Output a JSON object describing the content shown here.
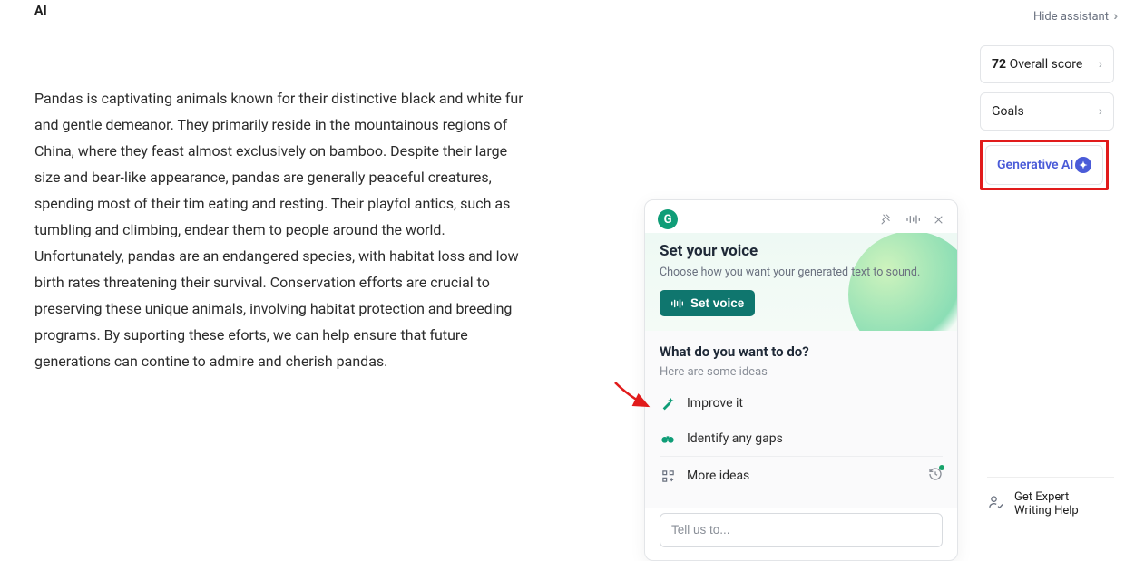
{
  "document": {
    "title": "AI",
    "body": "Pandas is captivating animals known for their distinctive black and white fur and gentle demeanor. They primarily reside in the mountainous regions of China, where they feast almost exclusively on bamboo. Despite their large size and bear-like appearance, pandas are generally peaceful creatures, spending most of their tim eating and resting. Their playfol antics, such as tumbling and climbing, endear them to people around the world. Unfortunately, pandas are an endangered species, with habitat loss and low birth rates threatening their survival. Conservation efforts are crucial to preserving these unique animals, involving habitat protection and breeding programs. By suporting these eforts, we can help ensure that future generations can contine to admire and cherish pandas."
  },
  "sidebar": {
    "hide_label": "Hide assistant",
    "score_num": "72",
    "score_label": "Overall score",
    "goals_label": "Goals",
    "genai_label": "Generative AI",
    "expert_line1": "Get Expert",
    "expert_line2": "Writing Help"
  },
  "assistant": {
    "logo_letter": "G",
    "voice_title": "Set your voice",
    "voice_sub": "Choose how you want your generated text to sound.",
    "set_voice_btn": "Set voice",
    "todo_title": "What do you want to do?",
    "todo_sub": "Here are some ideas",
    "ideas": {
      "improve": "Improve it",
      "gaps": "Identify any gaps",
      "more": "More ideas"
    },
    "input_placeholder": "Tell us to..."
  }
}
